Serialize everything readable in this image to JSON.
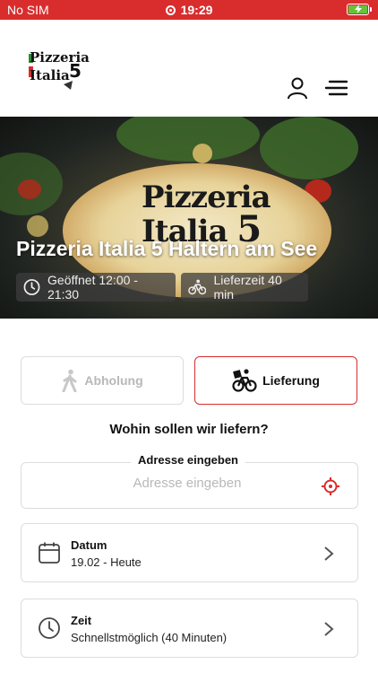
{
  "status_bar": {
    "carrier": "No SIM",
    "time": "19:29"
  },
  "logo": {
    "line1": "Pizzeria",
    "line2": "Italia",
    "number": "5"
  },
  "hero": {
    "title": "Pizzeria Italia 5 Haltern am See",
    "opening_hours": "Geöffnet 12:00 - 21:30",
    "delivery_time": "Lieferzeit 40 min",
    "overlay_line1": "Pizzeria",
    "overlay_line2": "Italia",
    "overlay_number": "5"
  },
  "modes": {
    "pickup": "Abholung",
    "delivery": "Lieferung",
    "selected": "delivery"
  },
  "question": "Wohin sollen wir liefern?",
  "address": {
    "legend": "Adresse eingeben",
    "placeholder": "Adresse eingeben",
    "value": ""
  },
  "date": {
    "label": "Datum",
    "value": "19.02 - Heute"
  },
  "time": {
    "label": "Zeit",
    "value": "Schnellstmöglich (40 Minuten)"
  },
  "colors": {
    "accent": "#d92d2d",
    "border": "#dddddd",
    "muted": "#b8b8b8"
  },
  "icons": [
    "user-icon",
    "hamburger-menu-icon",
    "clock-icon",
    "bicycle-icon",
    "walking-icon",
    "crosshair-icon",
    "calendar-icon",
    "chevron-right-icon"
  ]
}
